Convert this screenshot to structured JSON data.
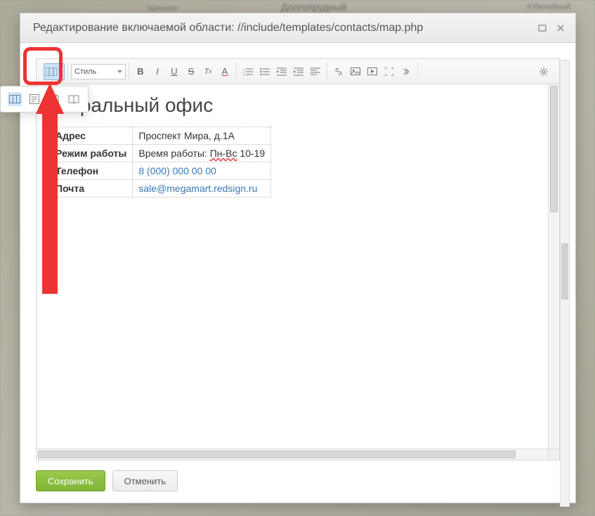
{
  "map": {
    "labels": [
      "Брехово",
      "Долгопрудный",
      "Юбилейный"
    ]
  },
  "dialog": {
    "title": "Редактирование включаемой области: //include/templates/contacts/map.php"
  },
  "toolbar": {
    "style_label": "Стиль",
    "buttons": {
      "bold": "B",
      "italic": "I",
      "underline": "U",
      "strike": "S",
      "clearfmt": "Tx",
      "color": "A"
    }
  },
  "content": {
    "heading_visible": "ентральный офис",
    "rows": [
      {
        "label": "Адрес",
        "value": "Проспект Мира, д.1А",
        "link": false
      },
      {
        "label": "Режим работы",
        "value_prefix": "Время работы: ",
        "value_spell": "Пн-Вс",
        "value_suffix": " 10-19",
        "link": false
      },
      {
        "label": "Телефон",
        "value": "8 (000) 000 00 00",
        "link": true
      },
      {
        "label": "Почта",
        "value": "sale@megamart.redsign.ru",
        "link": true
      }
    ]
  },
  "footer": {
    "save": "Сохранить",
    "cancel": "Отменить"
  }
}
